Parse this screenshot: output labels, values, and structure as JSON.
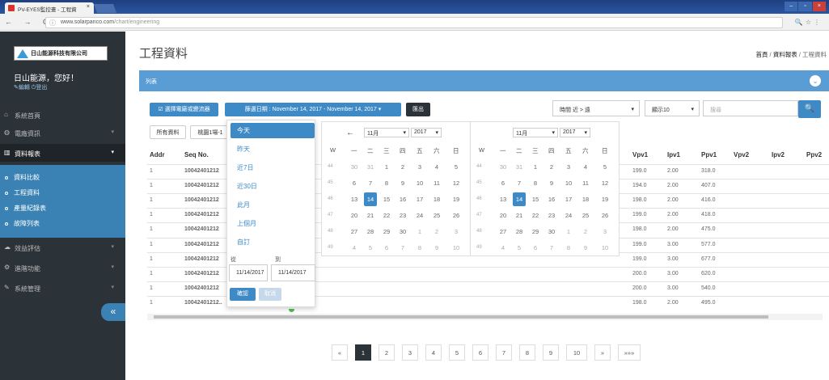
{
  "browser": {
    "tab_title": "PV-EYES監控畫 - 工程資",
    "url_host": "www.solarpanco.com",
    "url_path": "/chart/engineering",
    "nav_glyphs": "← → C ⌂"
  },
  "sidebar": {
    "logo_text": "日山能源科技有限公司",
    "greeting": "日山能源，您好！",
    "user_links": "✎編輯 ⏻登出",
    "menu": [
      {
        "label": "系統首頁",
        "icon": "home-icon"
      },
      {
        "label": "電廠資訊",
        "icon": "info-icon"
      },
      {
        "label": "資料報表",
        "icon": "chart-icon",
        "active": true
      },
      {
        "label": "效益評估",
        "icon": "cloud-icon"
      },
      {
        "label": "進階功能",
        "icon": "gear-icon"
      },
      {
        "label": "系統管理",
        "icon": "wrench-icon"
      }
    ],
    "submenu": [
      "資料比較",
      "工程資料",
      "產量紀錄表",
      "故障列表"
    ],
    "collapse": "«"
  },
  "header": {
    "title": "工程資料",
    "breadcrumb": [
      "首頁",
      "資料報表",
      "工程資料"
    ]
  },
  "panel": {
    "title": "列表"
  },
  "toolbar": {
    "select_plant": "☑ 選擇電廠或變流器",
    "date_range": "篩選日期 : November 14, 2017 - November 14, 2017 ▾",
    "export": "匯出",
    "sort": "時間 近 > 遠",
    "show": "顯示10",
    "search_placeholder": "搜尋",
    "all_data": "所有資料",
    "inverter": "桃園1場-1"
  },
  "table": {
    "headers": [
      "Addr",
      "Seq No.",
      "Vpv1",
      "Ipv1",
      "Ppv1",
      "Vpv2",
      "Ipv2",
      "Ppv2"
    ],
    "rows": [
      {
        "addr": "1",
        "seq": "10042401212",
        "vpv1": "199.0",
        "ipv1": "2.00",
        "ppv1": "318.0"
      },
      {
        "addr": "1",
        "seq": "10042401212",
        "vpv1": "194.0",
        "ipv1": "2.00",
        "ppv1": "407.0"
      },
      {
        "addr": "1",
        "seq": "10042401212",
        "vpv1": "198.0",
        "ipv1": "2.00",
        "ppv1": "416.0"
      },
      {
        "addr": "1",
        "seq": "10042401212",
        "vpv1": "199.0",
        "ipv1": "2.00",
        "ppv1": "418.0"
      },
      {
        "addr": "1",
        "seq": "10042401212",
        "vpv1": "198.0",
        "ipv1": "2.00",
        "ppv1": "475.0"
      },
      {
        "addr": "1",
        "seq": "10042401212",
        "vpv1": "199.0",
        "ipv1": "3.00",
        "ppv1": "577.0"
      },
      {
        "addr": "1",
        "seq": "10042401212",
        "vpv1": "199.0",
        "ipv1": "3.00",
        "ppv1": "677.0"
      },
      {
        "addr": "1",
        "seq": "10042401212",
        "vpv1": "200.0",
        "ipv1": "3.00",
        "ppv1": "620.0"
      },
      {
        "addr": "1",
        "seq": "10042401212",
        "vpv1": "200.0",
        "ipv1": "3.00",
        "ppv1": "540.0"
      },
      {
        "addr": "1",
        "seq": "10042401212..",
        "vpv1": "198.0",
        "ipv1": "2.00",
        "ppv1": "495.0"
      }
    ]
  },
  "range_menu": {
    "options": [
      "今天",
      "昨天",
      "近7日",
      "近30日",
      "此月",
      "上個月",
      "自訂"
    ],
    "from_label": "從",
    "to_label": "到",
    "from": "11/14/2017",
    "to": "11/14/2017",
    "apply": "確認",
    "cancel": "取消"
  },
  "calendar": {
    "prev": "←",
    "month": "11月",
    "year": "2017",
    "weekdays": [
      "W",
      "一",
      "二",
      "三",
      "四",
      "五",
      "六",
      "日"
    ],
    "weeks": [
      {
        "wk": "44",
        "days": [
          "30",
          "31",
          "1",
          "2",
          "3",
          "4",
          "5"
        ]
      },
      {
        "wk": "45",
        "days": [
          "6",
          "7",
          "8",
          "9",
          "10",
          "11",
          "12"
        ]
      },
      {
        "wk": "46",
        "days": [
          "13",
          "14",
          "15",
          "16",
          "17",
          "18",
          "19"
        ]
      },
      {
        "wk": "47",
        "days": [
          "20",
          "21",
          "22",
          "23",
          "24",
          "25",
          "26"
        ]
      },
      {
        "wk": "48",
        "days": [
          "27",
          "28",
          "29",
          "30",
          "1",
          "2",
          "3"
        ]
      },
      {
        "wk": "49",
        "days": [
          "4",
          "5",
          "6",
          "7",
          "8",
          "9",
          "10"
        ]
      }
    ]
  },
  "pagination": {
    "prev": "«",
    "pages": [
      "1",
      "2",
      "3",
      "4",
      "5",
      "6",
      "7",
      "8",
      "9",
      "10"
    ],
    "next": "»",
    "last": "»»»"
  }
}
